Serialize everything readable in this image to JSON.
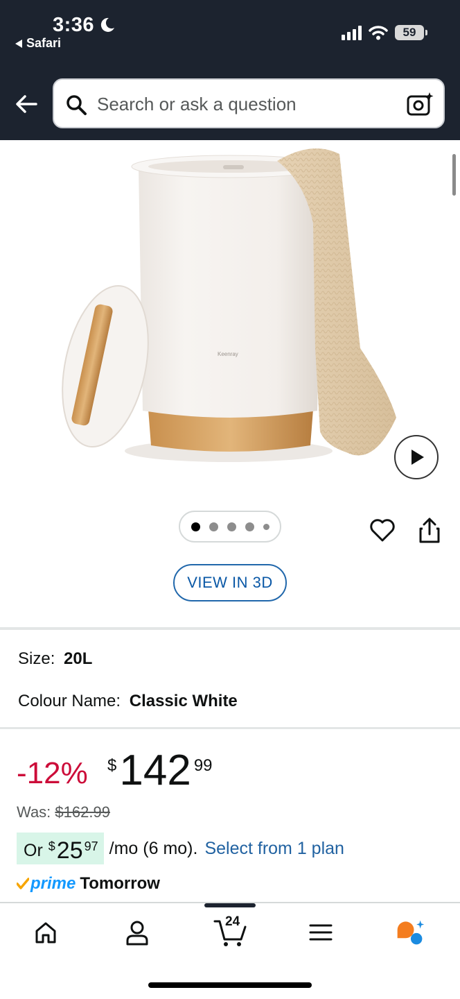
{
  "status_bar": {
    "time": "3:36",
    "back_app": "Safari",
    "battery": "59"
  },
  "search": {
    "placeholder": "Search or ask a question"
  },
  "product": {
    "image_brand_mark": "Keenray",
    "gallery_dots_total": 5,
    "gallery_active_index": 0,
    "view_3d_label": "VIEW IN 3D"
  },
  "variations": {
    "size_label": "Size:",
    "size_value": "20L",
    "colour_label": "Colour Name:",
    "colour_value": "Classic White"
  },
  "pricing": {
    "discount": "-12%",
    "currency": "$",
    "price_whole": "142",
    "price_fraction": "99",
    "was_label": "Was:",
    "was_price": "$162.99",
    "installment_prefix": "Or",
    "installment_currency": "$",
    "installment_whole": "25",
    "installment_fraction": "97",
    "installment_suffix": "/mo (6 mo).",
    "installment_link": "Select from 1 plan"
  },
  "delivery": {
    "prime_label": "prime",
    "delivery_day": "Tomorrow"
  },
  "tabbar": {
    "cart_count": "24"
  },
  "colors": {
    "header_bg": "#1c232f",
    "discount_red": "#cc0c39",
    "link_blue": "#2162a1",
    "prime_blue": "#1399ff",
    "installment_bg": "#d8f5e8",
    "rufus_orange": "#f47d1f",
    "rufus_blue": "#1b8be0"
  },
  "icons": [
    "moon-icon",
    "signal-icon",
    "wifi-icon",
    "battery-icon",
    "back-arrow-icon",
    "search-icon",
    "camera-lens-icon",
    "play-icon",
    "heart-icon",
    "share-icon",
    "prime-check-icon",
    "home-icon",
    "account-icon",
    "cart-icon",
    "menu-icon",
    "rufus-icon"
  ]
}
